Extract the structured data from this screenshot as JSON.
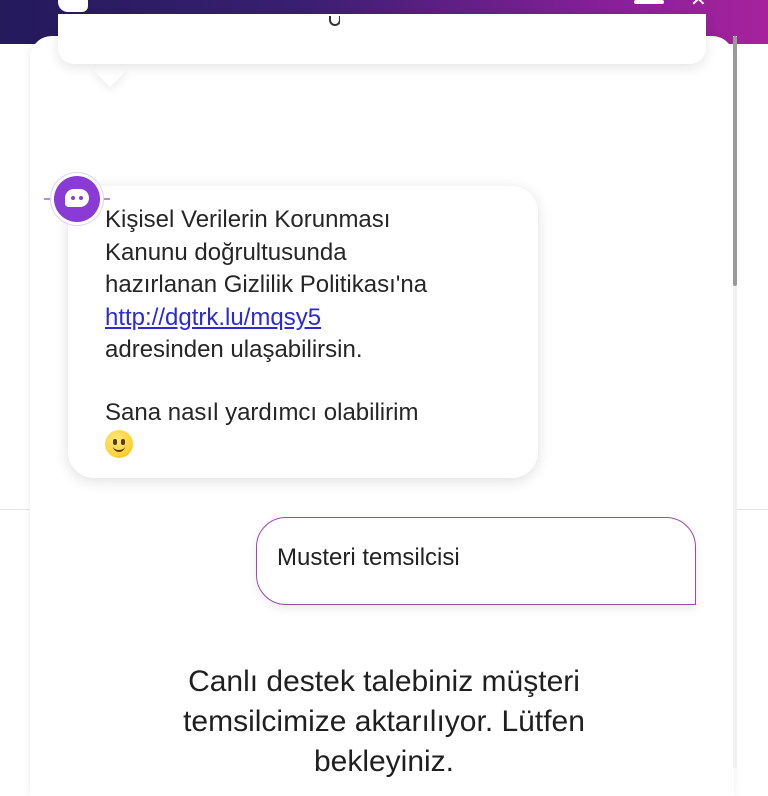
{
  "header": {
    "logo_icon": "chat-bubble-logo-icon",
    "menu_icon": "hamburger-menu-icon",
    "close_icon": "close-icon",
    "gradient_colors": [
      "#241a5c",
      "#8a1f9a",
      "#a6239c"
    ]
  },
  "messages": {
    "bot": {
      "avatar_icon": "bot-avatar-icon",
      "line1": "Kişisel Verilerin Korunması",
      "line2": "Kanunu doğrultusunda",
      "line3": "hazırlanan Gizlilik Politikası'na",
      "link": "http://dgtrk.lu/mqsy5",
      "line4": "adresinden ulaşabilirsin.",
      "question": "Sana nasıl yardımcı olabilirim",
      "emoji": "slightly-smiling-face-emoji"
    },
    "user": {
      "text": "Musteri temsilcisi",
      "border_color": "#a04aa8"
    },
    "system": {
      "line1": "Canlı destek talebiniz müşteri",
      "line2": "temsilcimize aktarılıyor. Lütfen",
      "line3": "bekleyiniz."
    }
  }
}
